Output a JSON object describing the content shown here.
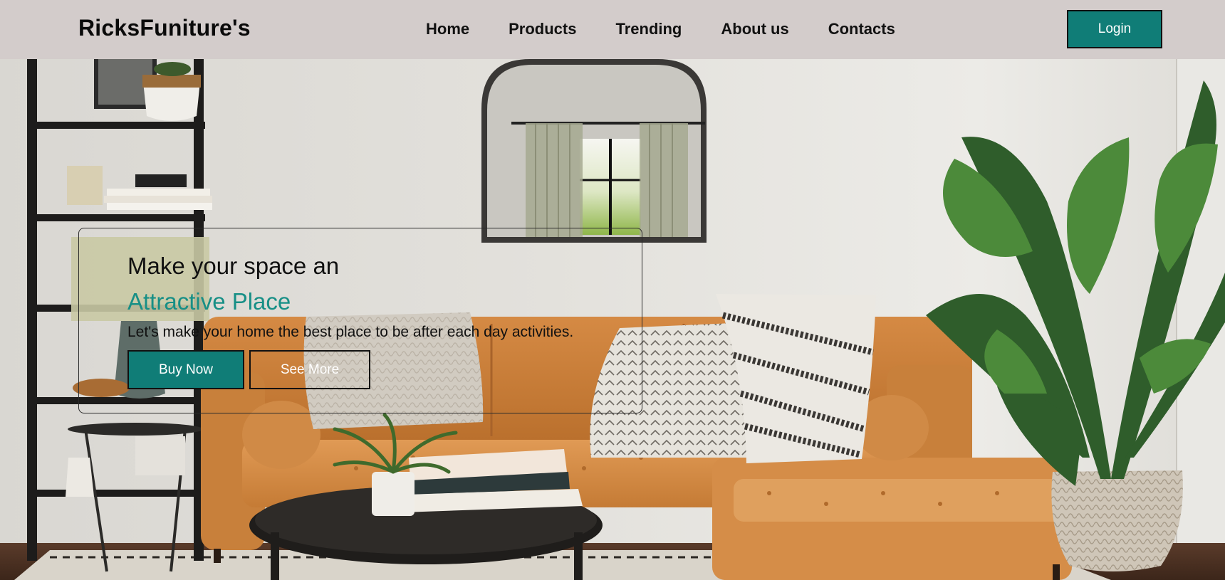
{
  "brand": {
    "name": "RicksFuniture's"
  },
  "nav": {
    "items": [
      {
        "label": "Home"
      },
      {
        "label": "Products"
      },
      {
        "label": "Trending"
      },
      {
        "label": "About us"
      },
      {
        "label": "Contacts"
      }
    ],
    "login_label": "Login"
  },
  "hero": {
    "title": "Make your space an",
    "highlight": "Attractive Place",
    "subtitle": "Let's make your home the best place to be after each day activities.",
    "buy_label": "Buy Now",
    "more_label": "See More",
    "image": "living-room-photo"
  },
  "colors": {
    "accent": "#107d77",
    "highlight_text": "#178f86",
    "header_bg": "#d3cccb"
  },
  "icons": {
    "hero_image": "sofa-living-room-scene"
  }
}
